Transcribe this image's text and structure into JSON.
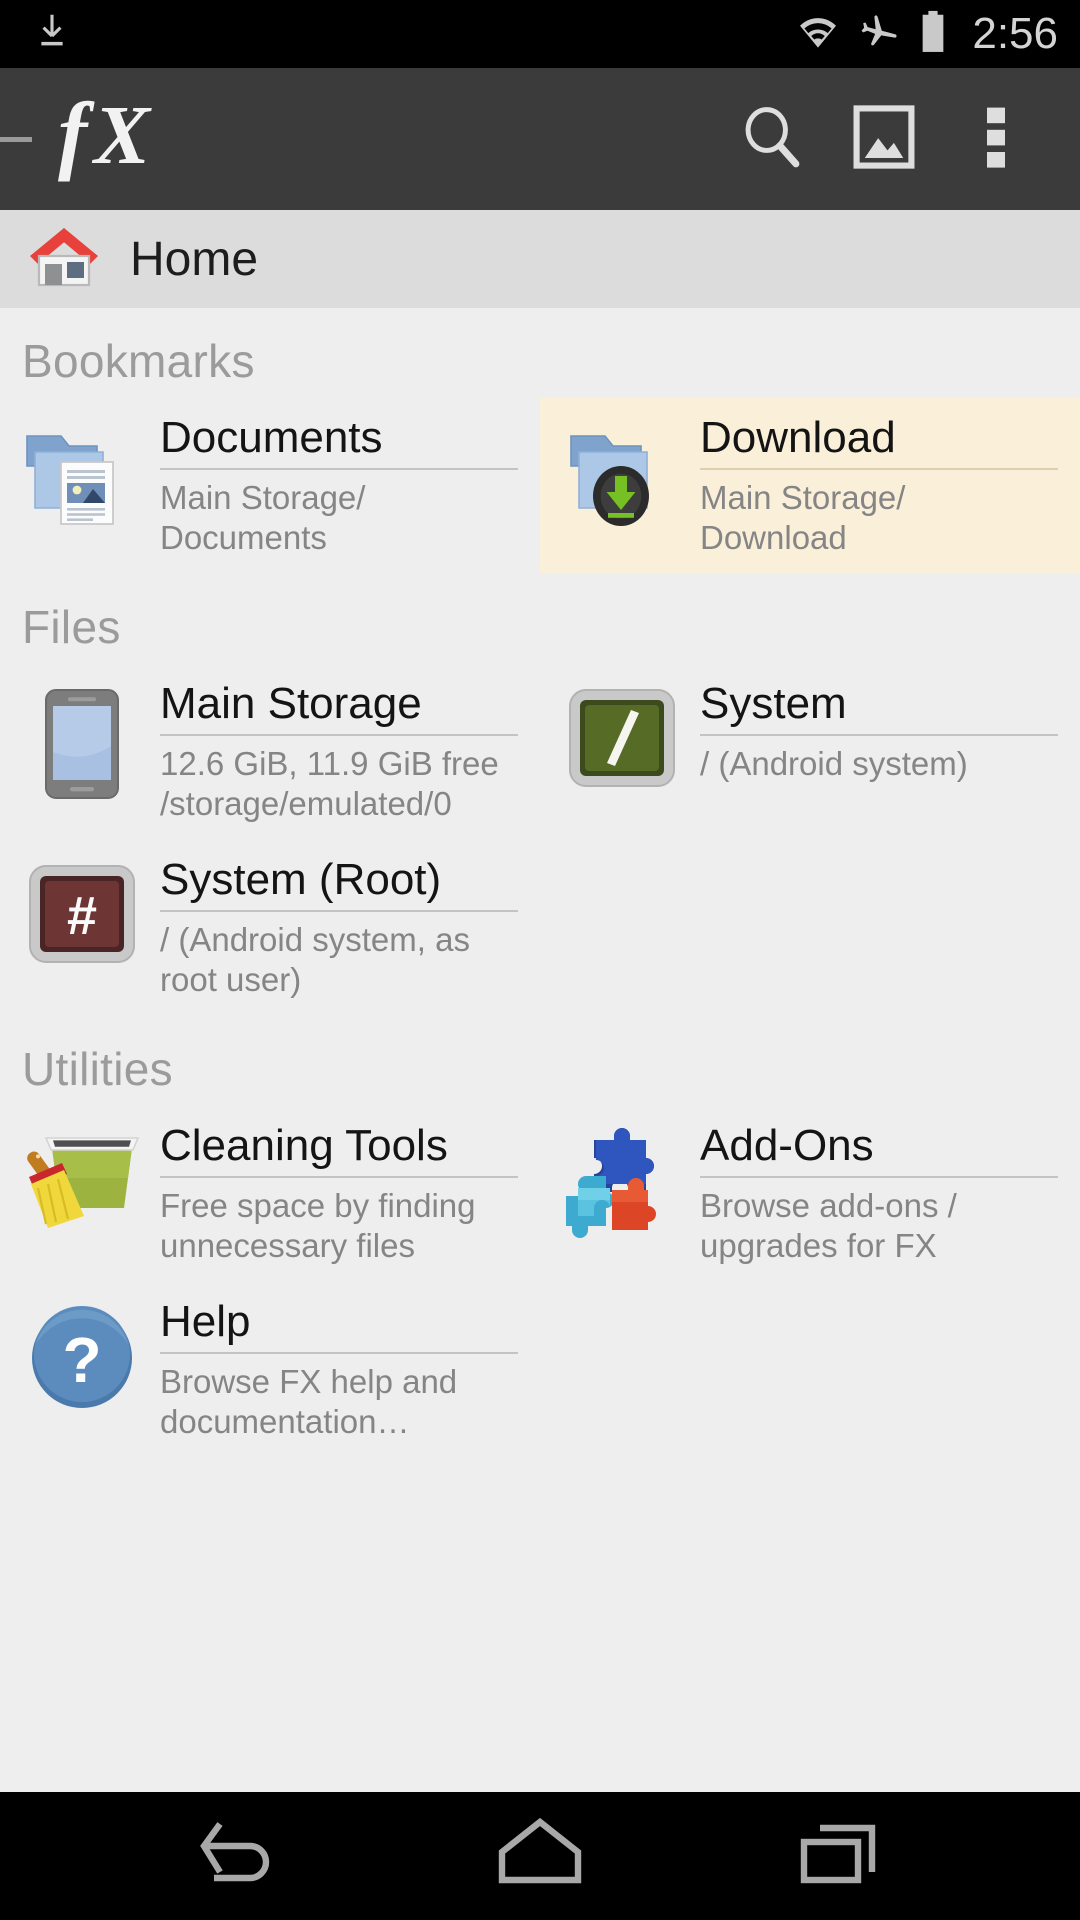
{
  "status_bar": {
    "notification_icon": "download-icon",
    "icons": [
      "wifi-icon",
      "airplane-mode-icon",
      "battery-icon"
    ],
    "clock": "2:56",
    "background": "#000000",
    "foreground": "#c8c8c8"
  },
  "app_bar": {
    "background": "#3b3b3b",
    "logo_text": "fx",
    "drawer_handle": "drawer-handle",
    "actions": [
      {
        "name": "search-icon",
        "label": "Search"
      },
      {
        "name": "gallery-icon",
        "label": "Gallery"
      },
      {
        "name": "overflow-menu-icon",
        "label": "More options"
      }
    ]
  },
  "breadcrumb": {
    "icon": "home-icon",
    "label": "Home",
    "background": "#dcdcdc"
  },
  "sections": [
    {
      "header": "Bookmarks",
      "items": [
        {
          "title": "Documents",
          "subtitle": "Main Storage/\nDocuments",
          "icon": "folder-documents-icon",
          "highlighted": false
        },
        {
          "title": "Download",
          "subtitle": "Main Storage/\nDownload",
          "icon": "folder-download-icon",
          "highlighted": true
        }
      ]
    },
    {
      "header": "Files",
      "items": [
        {
          "title": "Main Storage",
          "subtitle": "12.6 GiB, 11.9 GiB free\n/storage/emulated/0",
          "icon": "phone-storage-icon",
          "highlighted": false
        },
        {
          "title": "System",
          "subtitle": "/ (Android system)",
          "icon": "system-slash-icon",
          "highlighted": false
        },
        {
          "title": "System (Root)",
          "subtitle": "/ (Android system, as root user)",
          "icon": "system-root-hash-icon",
          "highlighted": false
        }
      ]
    },
    {
      "header": "Utilities",
      "items": [
        {
          "title": "Cleaning Tools",
          "subtitle": "Free space by finding unnecessary files",
          "icon": "cleaning-bucket-broom-icon",
          "highlighted": false
        },
        {
          "title": "Add-Ons",
          "subtitle": "Browse add-ons / upgrades for FX",
          "icon": "puzzle-pieces-icon",
          "highlighted": false
        },
        {
          "title": "Help",
          "subtitle": "Browse FX help and documentation…",
          "icon": "help-question-icon",
          "highlighted": false
        }
      ]
    }
  ],
  "nav_bar": {
    "background": "#000000",
    "buttons": [
      {
        "name": "nav-back-button",
        "label": "Back"
      },
      {
        "name": "nav-home-button",
        "label": "Home"
      },
      {
        "name": "nav-recents-button",
        "label": "Recents"
      }
    ]
  },
  "colors": {
    "content_background": "#eeeeee",
    "highlight_background": "#faf0da",
    "section_header": "#9b9b9b",
    "title": "#141414",
    "subtitle": "#858585",
    "divider": "#c4c4c4",
    "home_roof_red": "#e8413c"
  }
}
